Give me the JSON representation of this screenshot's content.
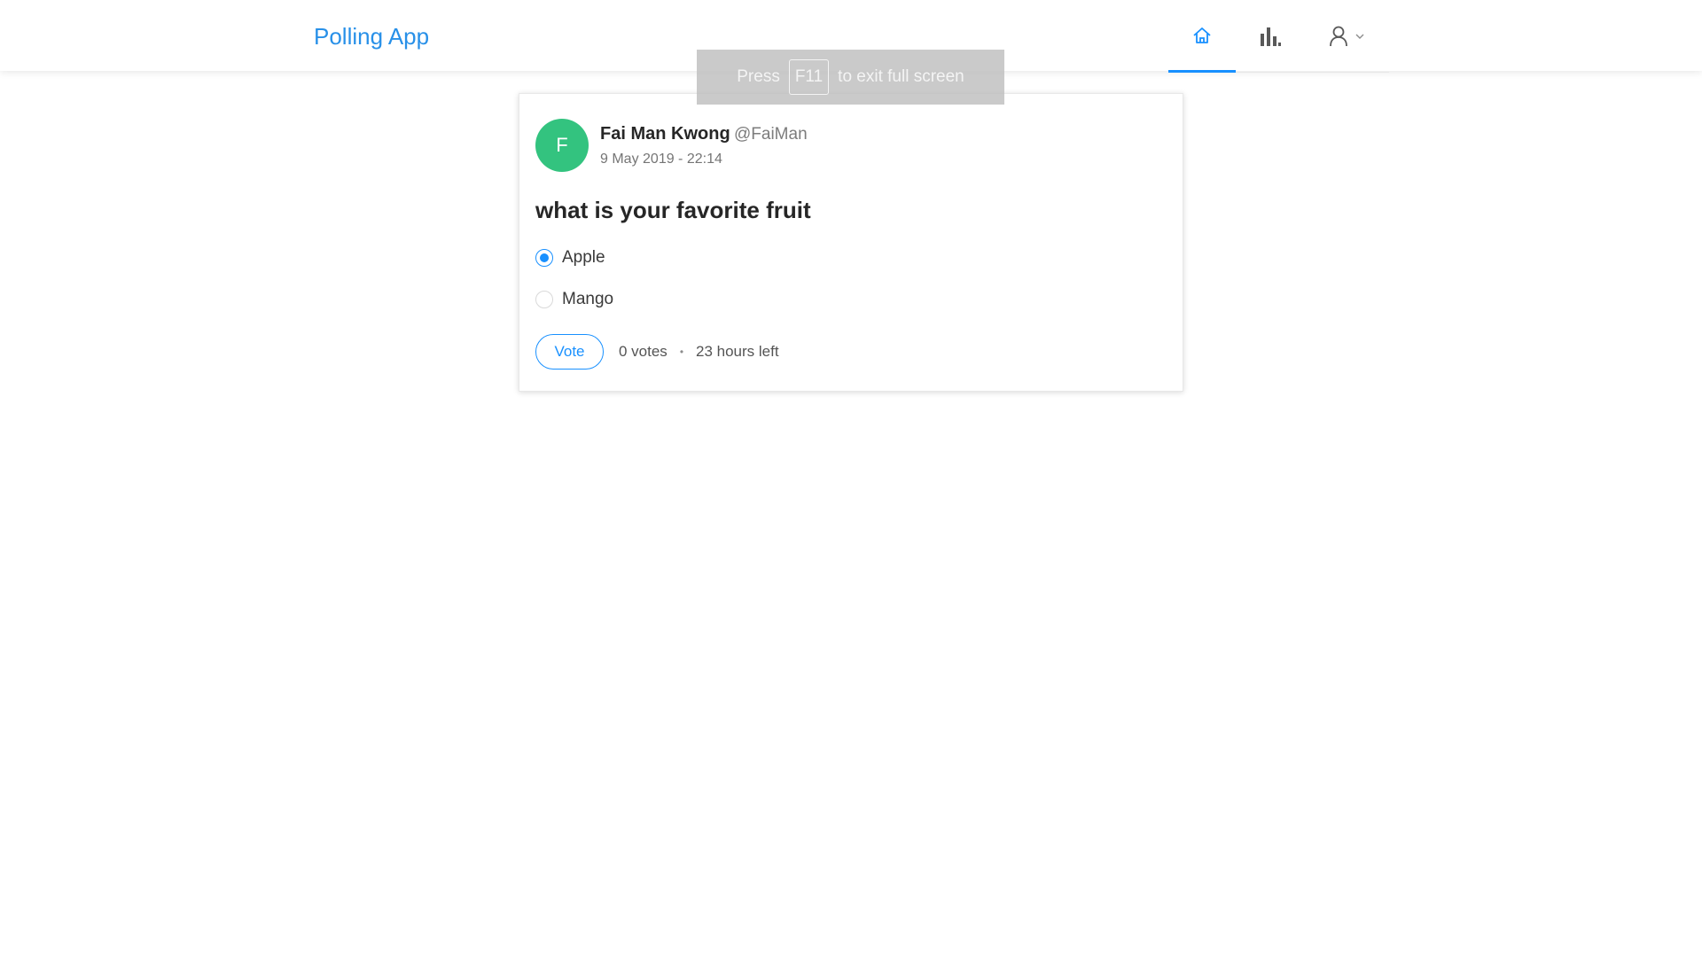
{
  "header": {
    "brand": "Polling App",
    "nav": {
      "home_icon": "home-icon",
      "poll_icon": "bar-chart-icon",
      "profile_icon": "user-icon",
      "profile_dropdown_icon": "chevron-down-icon",
      "active_item": "home"
    }
  },
  "fullscreen_notice": {
    "prefix": "Press",
    "key": "F11",
    "suffix": "to exit full screen"
  },
  "poll": {
    "avatar_letter": "F",
    "avatar_color": "#33c37f",
    "creator_name": "Fai Man Kwong",
    "creator_username": "@FaiMan",
    "created_at": "9 May 2019 - 22:14",
    "question": "what is your favorite fruit",
    "choices": [
      {
        "label": "Apple",
        "selected": true
      },
      {
        "label": "Mango",
        "selected": false
      }
    ],
    "vote_button": "Vote",
    "votes": "0 votes",
    "separator": "•",
    "time_left": "23 hours left"
  },
  "colors": {
    "accent": "#1890ff",
    "brand": "#2890e8"
  }
}
